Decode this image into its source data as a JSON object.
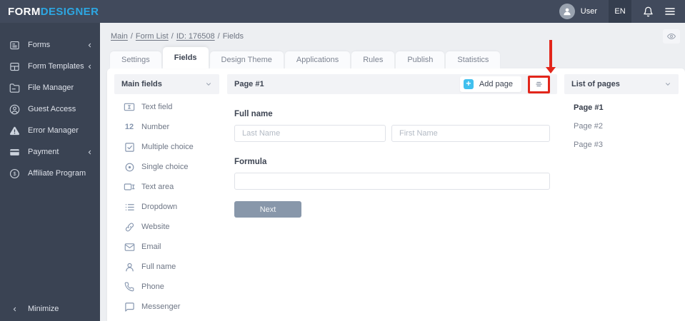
{
  "logo": {
    "part1": "FORM",
    "part2": "DESIGNER"
  },
  "topbar": {
    "user_label": "User",
    "language": "EN"
  },
  "sidebar": {
    "items": [
      {
        "label": "Forms"
      },
      {
        "label": "Form Templates"
      },
      {
        "label": "File Manager"
      },
      {
        "label": "Guest Access"
      },
      {
        "label": "Error Manager"
      },
      {
        "label": "Payment"
      },
      {
        "label": "Affiliate Program"
      }
    ],
    "minimize_label": "Minimize"
  },
  "breadcrumb": {
    "separator": "/",
    "links": [
      "Main",
      "Form List",
      "ID: 176508"
    ],
    "current": "Fields"
  },
  "tabs": [
    "Settings",
    "Fields",
    "Design Theme",
    "Applications",
    "Rules",
    "Publish",
    "Statistics"
  ],
  "active_tab": "Fields",
  "fields_panel": {
    "title": "Main fields",
    "number_icon_text": "12",
    "items": [
      "Text field",
      "Number",
      "Multiple choice",
      "Single choice",
      "Text area",
      "Dropdown",
      "Website",
      "Email",
      "Full name",
      "Phone",
      "Messenger"
    ]
  },
  "page_panel": {
    "title": "Page #1",
    "add_page_label": "Add page",
    "plus_glyph": "+",
    "form": {
      "full_name_label": "Full name",
      "last_name_placeholder": "Last Name",
      "first_name_placeholder": "First Name",
      "formula_label": "Formula",
      "next_button_label": "Next"
    }
  },
  "pages_panel": {
    "title": "List of pages",
    "items": [
      "Page #1",
      "Page #2",
      "Page #3"
    ]
  },
  "colors": {
    "topbar_bg": "#414a5c",
    "sidebar_bg": "#3a4353",
    "logo_accent": "#2da7e2",
    "add_page_blue": "#41c0ee",
    "annotation_red": "#e2261b",
    "panel_header_bg": "#f2f3f6",
    "next_button_bg": "#8897aa",
    "content_bg": "#edeff2"
  }
}
